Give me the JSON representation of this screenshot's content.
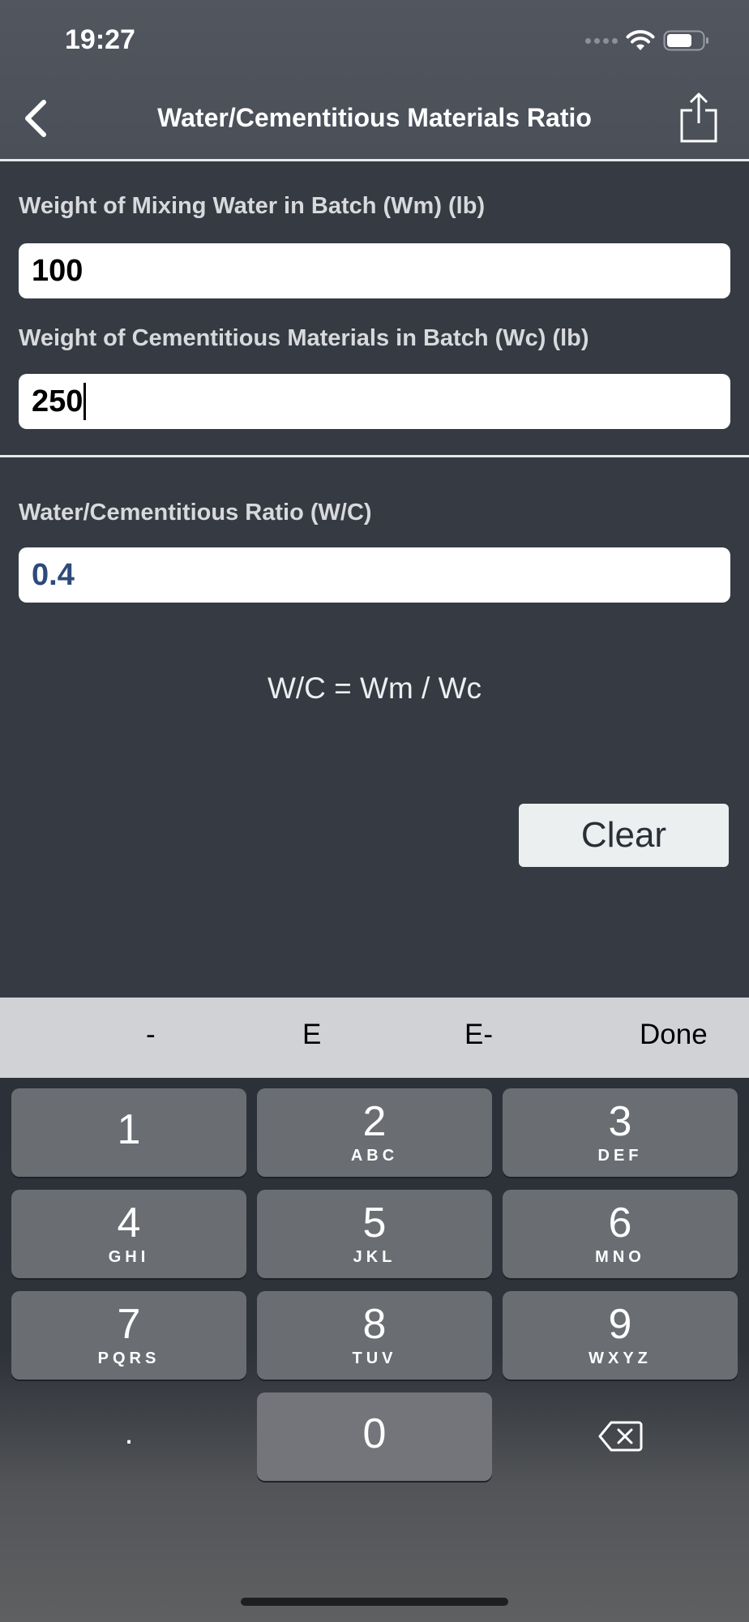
{
  "status": {
    "time": "19:27"
  },
  "nav": {
    "title": "Water/Cementitious Materials Ratio"
  },
  "inputs": {
    "wm_label": "Weight of Mixing Water in Batch (Wm) (lb)",
    "wm_value": "100",
    "wc_label": "Weight of Cementitious Materials in Batch (Wc) (lb)",
    "wc_value": "250"
  },
  "result": {
    "label": "Water/Cementitious Ratio (W/C)",
    "value": "0.4"
  },
  "formula": "W/C = Wm / Wc",
  "clear_label": "Clear",
  "keyboard_toolbar": {
    "minus": "-",
    "e": "E",
    "e_minus": "E-",
    "done": "Done"
  },
  "keys": [
    {
      "num": "1",
      "letters": ""
    },
    {
      "num": "2",
      "letters": "ABC"
    },
    {
      "num": "3",
      "letters": "DEF"
    },
    {
      "num": "4",
      "letters": "GHI"
    },
    {
      "num": "5",
      "letters": "JKL"
    },
    {
      "num": "6",
      "letters": "MNO"
    },
    {
      "num": "7",
      "letters": "PQRS"
    },
    {
      "num": "8",
      "letters": "TUV"
    },
    {
      "num": "9",
      "letters": "WXYZ"
    },
    {
      "num": "0",
      "letters": ""
    }
  ],
  "decimal_key": ".",
  "icons": {
    "back": "chevron-left-icon",
    "share": "share-icon",
    "wifi": "wifi-icon",
    "battery": "battery-icon",
    "backspace": "backspace-icon"
  }
}
